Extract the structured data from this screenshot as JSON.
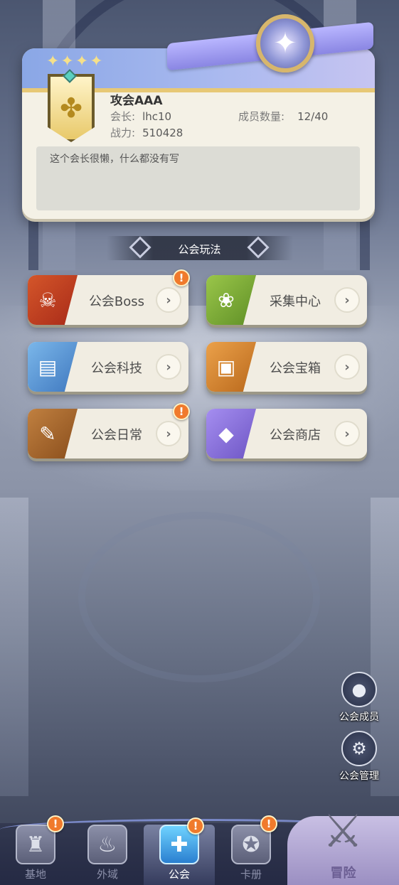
{
  "guild": {
    "name": "攻会AAA",
    "leader_label": "会长:",
    "leader_value": "lhc10",
    "power_label": "战力:",
    "power_value": "510428",
    "members_label": "成员数量:",
    "members_value": "12/40",
    "description": "这个会长很懒，什么都没有写"
  },
  "section": {
    "title": "公会玩法"
  },
  "features": [
    {
      "label": "公会Boss",
      "icon": "demon-skull-icon",
      "color": "#c8401f",
      "alert": true
    },
    {
      "label": "采集中心",
      "icon": "flower-icon",
      "color": "#7fae3a",
      "alert": false
    },
    {
      "label": "公会科技",
      "icon": "book-icon",
      "color": "#5b9ad6",
      "alert": false
    },
    {
      "label": "公会宝箱",
      "icon": "chest-icon",
      "color": "#d98a2c",
      "alert": false
    },
    {
      "label": "公会日常",
      "icon": "feather-icon",
      "color": "#a8662a",
      "alert": true
    },
    {
      "label": "公会商店",
      "icon": "diamond-icon",
      "color": "#8c72d8",
      "alert": false
    }
  ],
  "side_buttons": {
    "members": {
      "label": "公会成员",
      "icon": "member-icon"
    },
    "manage": {
      "label": "公会管理",
      "icon": "gear-icon"
    }
  },
  "nav": {
    "base": {
      "label": "基地",
      "icon": "base-icon",
      "alert": true
    },
    "outer": {
      "label": "外域",
      "icon": "flame-icon",
      "alert": false
    },
    "guild": {
      "label": "公会",
      "icon": "guild-shield-icon",
      "alert": true,
      "active": true
    },
    "cards": {
      "label": "卡册",
      "icon": "card-album-icon",
      "alert": true
    },
    "adventure": {
      "label": "冒险",
      "icon": "crossed-swords-icon"
    }
  },
  "alert_glyph": "!"
}
